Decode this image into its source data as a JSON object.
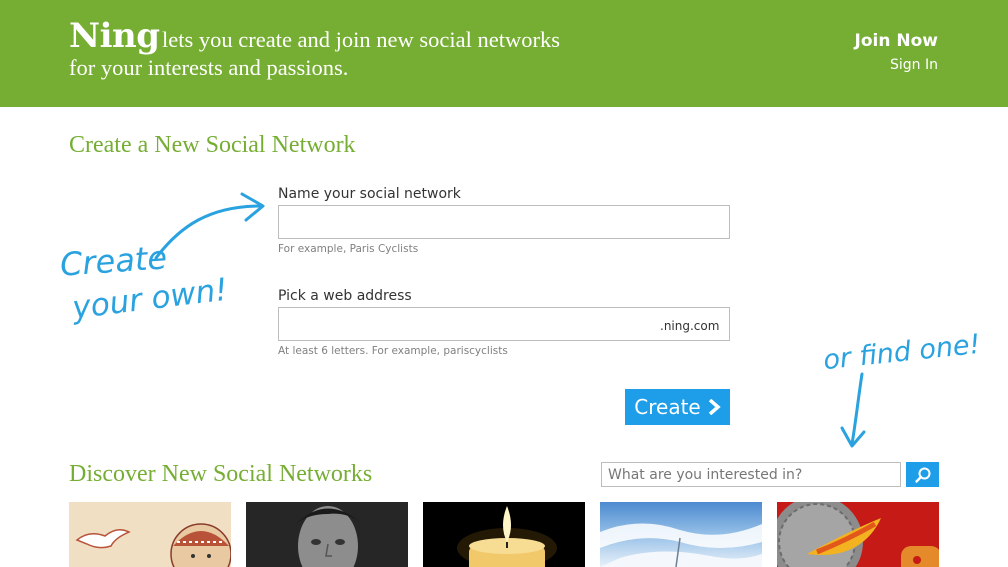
{
  "header": {
    "logo": "Ning",
    "tagline_line1": "lets you create and join new social networks",
    "tagline_line2": "for your interests and passions.",
    "join_now": "Join Now",
    "sign_in": "Sign In"
  },
  "create": {
    "heading": "Create a New Social Network",
    "name_label": "Name your social network",
    "name_value": "",
    "name_hint": "For example, Paris Cyclists",
    "address_label": "Pick a web address",
    "address_value": "",
    "address_suffix": ".ning.com",
    "address_hint": "At least 6 letters. For example, pariscyclists",
    "button_label": "Create",
    "annotation_line1": "Create",
    "annotation_line2": "your own!"
  },
  "discover": {
    "heading": "Discover New Social Networks",
    "search_placeholder": "What are you interested in?",
    "annotation": "or find one!",
    "tiles": [
      "illustration-bird-and-character",
      "portrait-man",
      "candle",
      "sky-clouds",
      "red-disc-graphic"
    ]
  },
  "colors": {
    "brand_green": "#76ae34",
    "accent_blue": "#1e9ee8",
    "script_blue": "#2aa2e0"
  },
  "icons": [
    "chevron-right-icon",
    "search-icon",
    "arrow-icon"
  ]
}
